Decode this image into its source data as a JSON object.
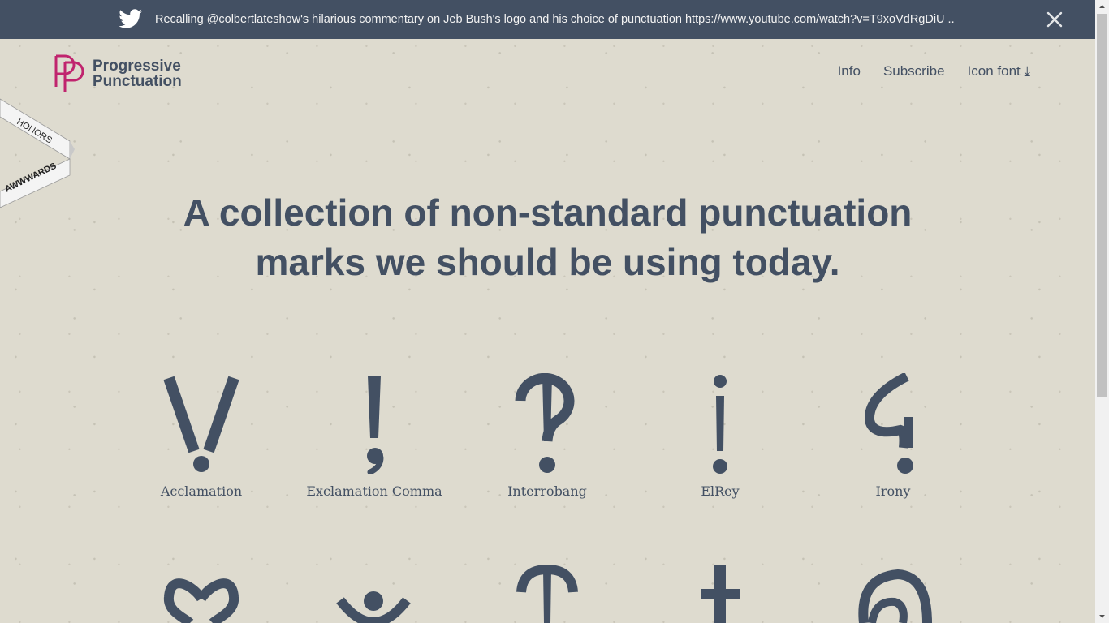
{
  "banner": {
    "icon": "twitter-bird-icon",
    "text": "Recalling @colbertlateshow's hilarious commentary on Jeb Bush's logo and his choice of punctuation https://www.youtube.com/watch?v=T9xoVdRgDiU ...",
    "close_icon": "close-icon"
  },
  "logo": {
    "line1": "Progressive",
    "line2": "Punctuation",
    "brand_color": "#c0246e"
  },
  "nav": {
    "info": "Info",
    "subscribe": "Subscribe",
    "icon_font": "Icon font ⤓"
  },
  "ribbon": {
    "line1": "HONORS",
    "line2": "AWWWARDS"
  },
  "headline": {
    "line1": "A collection of non-standard punctuation",
    "line2": "marks we should be using today."
  },
  "marks": [
    {
      "label": "Acclamation",
      "icon": "acclamation-icon"
    },
    {
      "label": "Exclamation Comma",
      "icon": "exclamation-comma-icon"
    },
    {
      "label": "Interrobang",
      "icon": "interrobang-icon"
    },
    {
      "label": "ElRey",
      "icon": "elrey-icon"
    },
    {
      "label": "Irony",
      "icon": "irony-icon"
    }
  ],
  "marks_row2_icons": [
    "love-point-icon",
    "certitude-point-icon",
    "doubt-point-icon",
    "authority-point-icon",
    "snark-icon"
  ],
  "colors": {
    "ink": "#435063",
    "background": "#dedbcf",
    "banner": "#435063"
  }
}
